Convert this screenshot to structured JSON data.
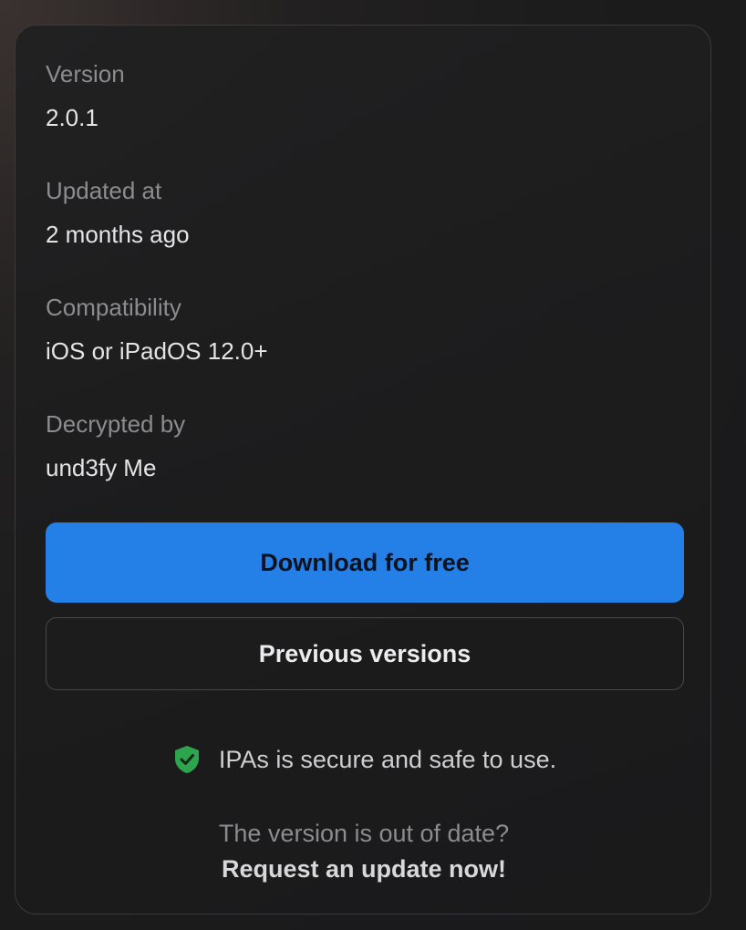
{
  "details": {
    "version": {
      "label": "Version",
      "value": "2.0.1"
    },
    "updated": {
      "label": "Updated at",
      "value": "2 months ago"
    },
    "compatibility": {
      "label": "Compatibility",
      "value": "iOS or iPadOS 12.0+"
    },
    "decrypted": {
      "label": "Decrypted by",
      "value": "und3fy Me"
    }
  },
  "actions": {
    "download_label": "Download for free",
    "previous_label": "Previous versions"
  },
  "security": {
    "icon": "shield-check-icon",
    "text": "IPAs is secure and safe to use.",
    "icon_color": "#2ea44f"
  },
  "update": {
    "prompt": "The version is out of date?",
    "link_label": "Request an update now!"
  },
  "colors": {
    "accent": "#2480e6"
  }
}
